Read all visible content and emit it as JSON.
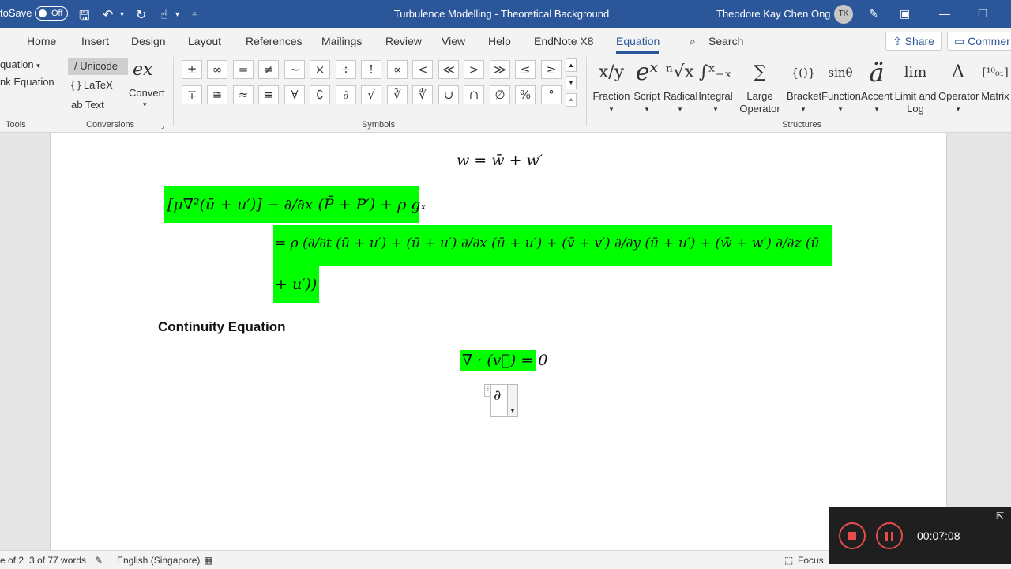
{
  "titlebar": {
    "autosave_label": "toSave",
    "autosave_state": "Off",
    "doc_title": "Turbulence Modelling - Theoretical Background",
    "user_name": "Theodore Kay Chen Ong",
    "user_initials": "TK"
  },
  "tabs": [
    "Home",
    "Insert",
    "Design",
    "Layout",
    "References",
    "Mailings",
    "Review",
    "View",
    "Help",
    "EndNote X8",
    "Equation"
  ],
  "active_tab": "Equation",
  "search_label": "Search",
  "share_label": "Share",
  "comments_label": "Commer",
  "ribbon": {
    "tools": {
      "equation_label": "quation",
      "ink_label": "nk Equation",
      "group_label": "Tools"
    },
    "conversions": {
      "unicode": "Unicode",
      "latex": "LaTeX",
      "text": "Text",
      "convert": "Convert",
      "group_label": "Conversions"
    },
    "symbols": {
      "row1": [
        "±",
        "∞",
        "=",
        "≠",
        "~",
        "×",
        "÷",
        "!",
        "∝",
        "<",
        "≪",
        ">",
        "≫",
        "≤",
        "≥"
      ],
      "row2": [
        "∓",
        "≅",
        "≈",
        "≡",
        "∀",
        "∁",
        "∂",
        "√",
        "∛",
        "∜",
        "∪",
        "∩",
        "∅",
        "%",
        "°"
      ],
      "group_label": "Symbols"
    },
    "structures": {
      "items": [
        {
          "label": "Fraction",
          "glyph": "x/y"
        },
        {
          "label": "Script",
          "glyph": "eˣ"
        },
        {
          "label": "Radical",
          "glyph": "ⁿ√x"
        },
        {
          "label": "Integral",
          "glyph": "∫ˣ₋ₓ"
        },
        {
          "label": "Large",
          "label2": "Operator",
          "glyph": "∑"
        },
        {
          "label": "Bracket",
          "glyph": "{()}"
        },
        {
          "label": "Function",
          "glyph": "sinθ"
        },
        {
          "label": "Accent",
          "glyph": "ä"
        },
        {
          "label": "Limit and",
          "label2": "Log",
          "glyph": "lim"
        },
        {
          "label": "Operator",
          "glyph": "Δ"
        },
        {
          "label": "Matrix",
          "glyph": "[¹⁰₀₁]"
        }
      ],
      "group_label": "Structures"
    }
  },
  "document": {
    "eq_w": "w = w̄ + w′",
    "eq_lhs": "[μ∇²(ū + u′)] − ∂/∂x (P̄ + P′) + ρ gₓ",
    "eq_rhs1": "= ρ (∂/∂t (ū + u′) + (ū + u′) ∂/∂x (ū + u′) + (v̄ + v′) ∂/∂y (ū + u′) + (w̄ + w′) ∂/∂z (ū",
    "eq_rhs2": "+ u′))",
    "heading": "Continuity Equation",
    "eq_continuity": "∇ · (v⃗) = 0",
    "eq_editing": "∂"
  },
  "statusbar": {
    "page": "e of 2",
    "words": "3 of 77 words",
    "language": "English (Singapore)",
    "focus": "Focus"
  },
  "recorder": {
    "time": "00:07:08"
  },
  "colors": {
    "accent": "#2b579a",
    "highlight": "#00ff00",
    "record": "#e74c4c"
  }
}
